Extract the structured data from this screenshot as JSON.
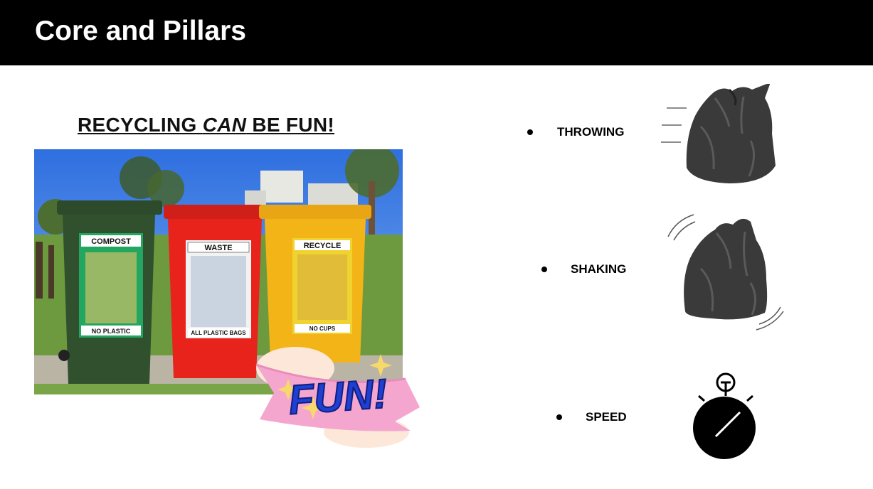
{
  "header": {
    "title": "Core and Pillars"
  },
  "left": {
    "subtitle_pre": "RECYCLING ",
    "subtitle_emph": "CAN",
    "subtitle_post": " BE FUN!",
    "bins": [
      {
        "top_label": "COMPOST",
        "bottom_label": "NO PLASTIC",
        "color": "#2f4a2c"
      },
      {
        "top_label": "WASTE",
        "bottom_label": "ALL PLASTIC BAGS",
        "color": "#e8231c"
      },
      {
        "top_label": "RECYCLE",
        "bottom_label": "NO CUPS",
        "color": "#f3b418"
      }
    ],
    "sticker_text": "FUN!"
  },
  "pillars": [
    {
      "label": "THROWING",
      "icon": "trash-bag-throwing-icon"
    },
    {
      "label": "SHAKING",
      "icon": "trash-bag-shaking-icon"
    },
    {
      "label": "SPEED",
      "icon": "stopwatch-icon"
    }
  ],
  "colors": {
    "header_bg": "#000000",
    "sticker_pink": "#f5a6cf",
    "sticker_blue": "#1f3fd1"
  }
}
